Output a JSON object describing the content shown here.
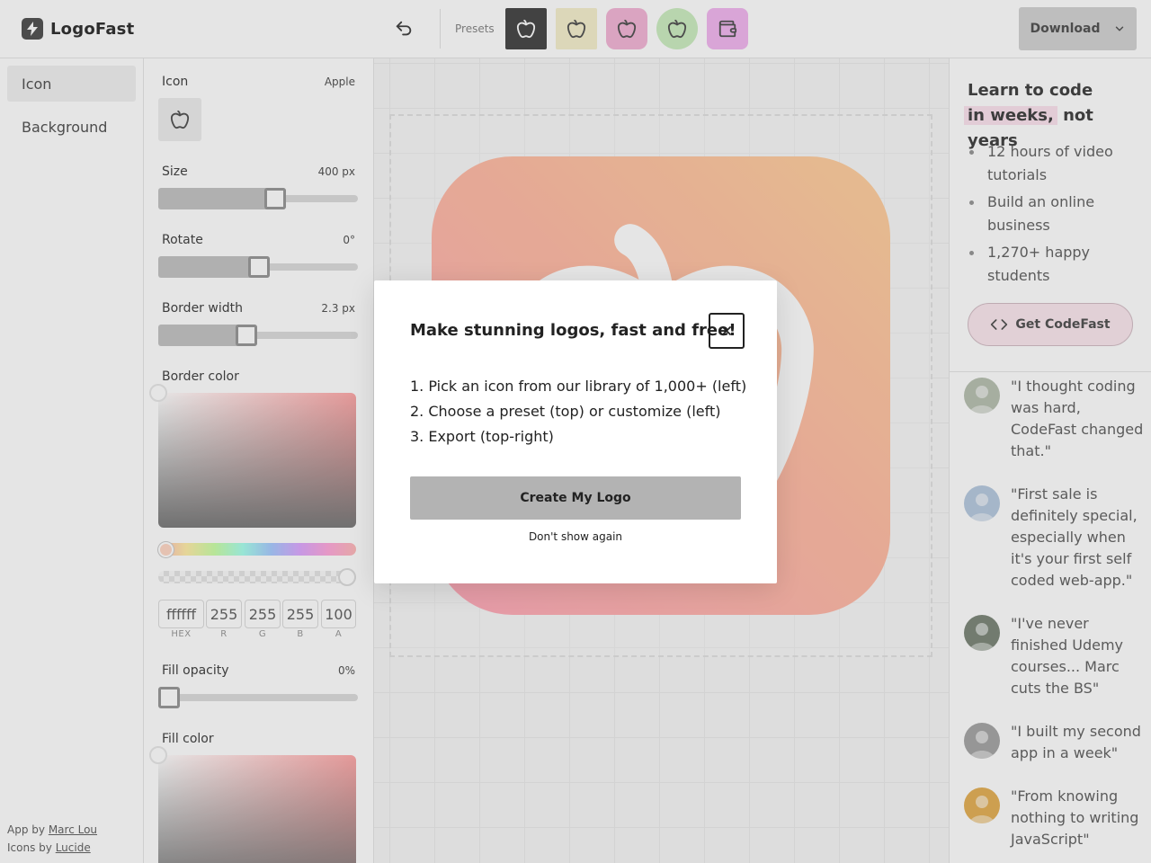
{
  "app": {
    "name": "LogoFast"
  },
  "toolbar": {
    "presets_label": "Presets",
    "presets": [
      {
        "bg": "#4a4a4a",
        "radius": "2px",
        "stroke": "#ffffff",
        "icon": "apple-icon"
      },
      {
        "bg": "#f5f0cf",
        "radius": "2px",
        "stroke": "#555555",
        "icon": "apple-icon"
      },
      {
        "bg": "#f3b7d7",
        "radius": "10px",
        "stroke": "#555555",
        "icon": "apple-icon"
      },
      {
        "bg": "#cdeec2",
        "radius": "50%",
        "stroke": "#555555",
        "icon": "apple-icon"
      },
      {
        "bg": "#f2b8f0",
        "radius": "8px",
        "stroke": "#555555",
        "icon": "wallet-icon"
      }
    ],
    "download_label": "Download"
  },
  "nav": {
    "items": [
      {
        "label": "Icon",
        "active": true
      },
      {
        "label": "Background",
        "active": false
      }
    ]
  },
  "credits": {
    "app_prefix": "App by",
    "app_author": "Marc Lou",
    "icons_prefix": "Icons by",
    "icons_author": "Lucide"
  },
  "settings": {
    "icon": {
      "label": "Icon",
      "value": "Apple"
    },
    "size": {
      "label": "Size",
      "value": "400 px",
      "fraction": 0.59
    },
    "rotate": {
      "label": "Rotate",
      "value": "0°",
      "fraction": 0.5
    },
    "border_width": {
      "label": "Border width",
      "value": "2.3 px",
      "fraction": 0.46
    },
    "border_color": {
      "label": "Border color",
      "hex": "ffffff",
      "r": "255",
      "g": "255",
      "b": "255",
      "a": "100",
      "labels": {
        "hex": "HEX",
        "r": "R",
        "g": "G",
        "b": "B",
        "a": "A"
      }
    },
    "fill_opacity": {
      "label": "Fill opacity",
      "value": "0%",
      "fraction": 0.0
    },
    "fill_color": {
      "label": "Fill color"
    }
  },
  "promo": {
    "title_line1": "Learn to code",
    "title_highlight": "in weeks,",
    "title_rest": "not years",
    "bullets": [
      "12 hours of video tutorials",
      "Build an online business",
      "1,270+ happy students"
    ],
    "cta_label": "Get CodeFast"
  },
  "testimonials": [
    {
      "quote": "\"I thought coding was hard, CodeFast changed that.\"",
      "avatar": "#b9c2b3"
    },
    {
      "quote": "\"First sale is definitely special, especially when it's your first self coded web-app.\"",
      "avatar": "#b8cbe0"
    },
    {
      "quote": "\"I've never finished Udemy courses... Marc cuts the BS\"",
      "avatar": "#7f8a7c"
    },
    {
      "quote": "\"I built my second app in a week\"",
      "avatar": "#a7a7a7"
    },
    {
      "quote": "\"From knowing nothing to writing JavaScript\"",
      "avatar": "#e5b25a"
    }
  ],
  "modal": {
    "title": "Make stunning logos, fast and free!",
    "steps": [
      "1. Pick an icon from our library of 1,000+ (left)",
      "2. Choose a preset (top) or customize (left)",
      "3. Export (top-right)"
    ],
    "create_label": "Create My Logo",
    "dont_show_label": "Don't show again"
  },
  "colors": {
    "logo_gradient_start": "#ffabbc",
    "logo_gradient_end": "#ffd2a0",
    "promo_highlight": "#fce4ef"
  }
}
